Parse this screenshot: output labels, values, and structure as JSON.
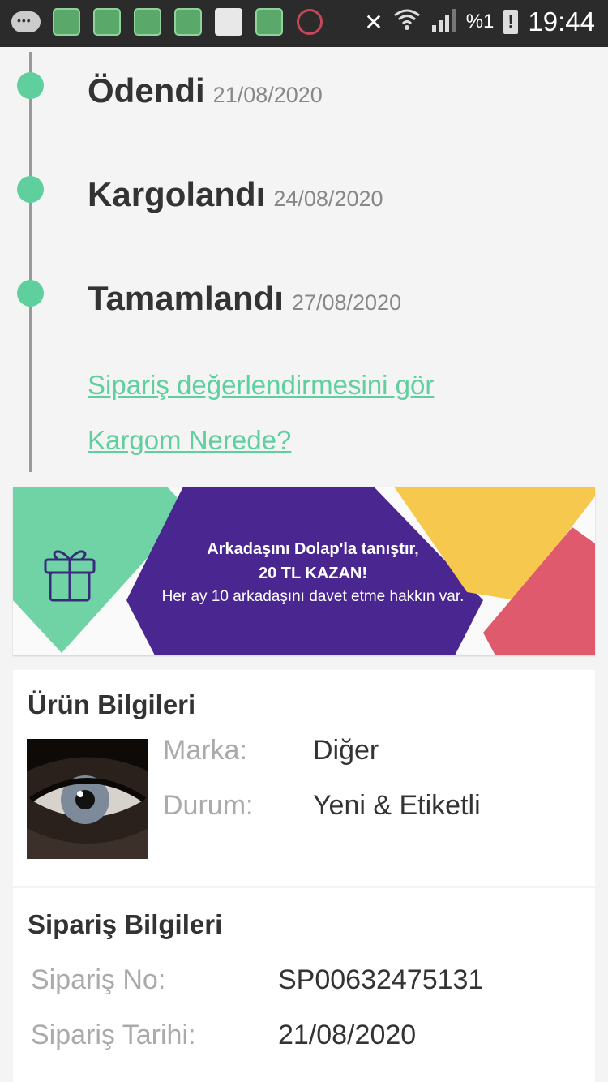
{
  "status_bar": {
    "battery_percent": "%1",
    "time": "19:44"
  },
  "timeline": {
    "steps": [
      {
        "title": "Ödendi",
        "date": "21/08/2020"
      },
      {
        "title": "Kargolandı",
        "date": "24/08/2020"
      },
      {
        "title": "Tamamlandı",
        "date": "27/08/2020"
      }
    ],
    "links": {
      "review": "Sipariş değerlendirmesini gör",
      "tracking": "Kargom Nerede?"
    }
  },
  "banner": {
    "line1": "Arkadaşını Dolap'la tanıştır,",
    "line2": "20 TL KAZAN!",
    "line3": "Her ay 10 arkadaşını davet etme hakkın var.",
    "colors": {
      "green": "#6fd3a6",
      "purple": "#4a2790",
      "yellow": "#f6c84d",
      "red": "#e05a6d"
    }
  },
  "product": {
    "title": "Ürün Bilgileri",
    "brand_label": "Marka:",
    "brand_value": "Diğer",
    "condition_label": "Durum:",
    "condition_value": "Yeni & Etiketli"
  },
  "order": {
    "title": "Sipariş Bilgileri",
    "number_label": "Sipariş No:",
    "number_value": "SP00632475131",
    "date_label": "Sipariş Tarihi:",
    "date_value": "21/08/2020"
  },
  "colors": {
    "accent": "#5fcf9e",
    "status_bar": "#2b2b2b"
  }
}
